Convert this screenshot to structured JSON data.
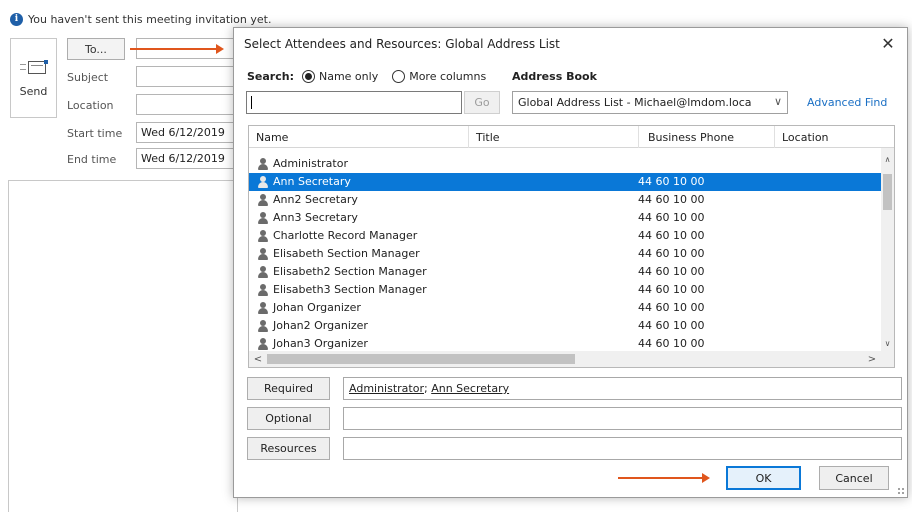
{
  "infobar": {
    "icon": "info-icon",
    "glyph": "i",
    "text": "You haven't sent this meeting invitation yet."
  },
  "meeting": {
    "send_label": "Send",
    "to_label": "To...",
    "fields": {
      "subject_label": "Subject",
      "location_label": "Location",
      "start_label": "Start time",
      "start_value": "Wed 6/12/2019",
      "end_label": "End time",
      "end_value": "Wed 6/12/2019"
    }
  },
  "dialog": {
    "title": "Select Attendees and Resources: Global Address List",
    "close_glyph": "✕",
    "search": {
      "label": "Search:",
      "option_name_only": "Name only",
      "option_more_columns": "More columns",
      "selected_option": "Name only",
      "input_value": "",
      "go_label": "Go"
    },
    "address_book": {
      "label": "Address Book",
      "selected": "Global Address List - Michael@lmdom.loca",
      "chevron": "∨",
      "advanced_find": "Advanced Find"
    },
    "columns": [
      "Name",
      "Title",
      "Business Phone",
      "Location"
    ],
    "rows": [
      {
        "name": "Administrator",
        "title": "",
        "phone": "",
        "location": ""
      },
      {
        "name": "Ann Secretary",
        "title": "",
        "phone": "44 60 10 00",
        "location": "",
        "selected": true
      },
      {
        "name": "Ann2 Secretary",
        "title": "",
        "phone": "44 60 10 00",
        "location": ""
      },
      {
        "name": "Ann3 Secretary",
        "title": "",
        "phone": "44 60 10 00",
        "location": ""
      },
      {
        "name": "Charlotte Record Manager",
        "title": "",
        "phone": "44 60 10 00",
        "location": ""
      },
      {
        "name": "Elisabeth Section Manager",
        "title": "",
        "phone": "44 60 10 00",
        "location": ""
      },
      {
        "name": "Elisabeth2 Section Manager",
        "title": "",
        "phone": "44 60 10 00",
        "location": ""
      },
      {
        "name": "Elisabeth3 Section Manager",
        "title": "",
        "phone": "44 60 10 00",
        "location": ""
      },
      {
        "name": "Johan Organizer",
        "title": "",
        "phone": "44 60 10 00",
        "location": ""
      },
      {
        "name": "Johan2 Organizer",
        "title": "",
        "phone": "44 60 10 00",
        "location": ""
      },
      {
        "name": "Johan3 Organizer",
        "title": "",
        "phone": "44 60 10 00",
        "location": ""
      }
    ],
    "scroll_glyphs": {
      "up": "∧",
      "down": "∨",
      "left": "<",
      "right": ">"
    },
    "recipients": {
      "required_label": "Required",
      "required_entries": [
        "Administrator",
        "Ann Secretary"
      ],
      "required_separator": "; ",
      "optional_label": "Optional",
      "optional_value": "",
      "resources_label": "Resources",
      "resources_value": ""
    },
    "ok_label": "OK",
    "cancel_label": "Cancel"
  },
  "colors": {
    "selection": "#0a78d7",
    "link": "#1a6fc4",
    "annotation_arrow": "#e0561d",
    "info_icon": "#1f5fa8"
  }
}
